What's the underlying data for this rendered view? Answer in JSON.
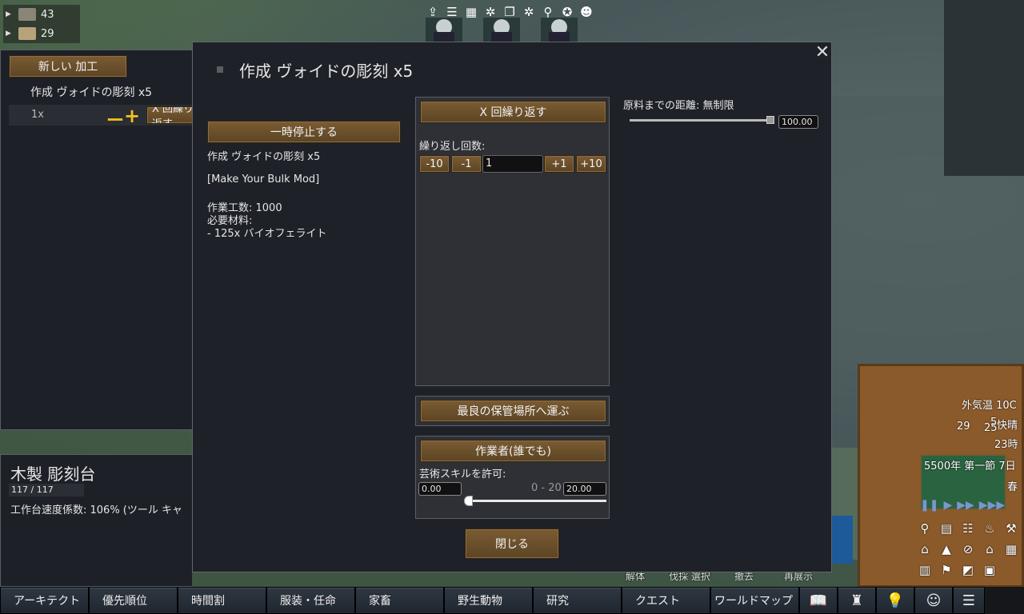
{
  "resources": [
    {
      "icon": "stone-chunk-icon",
      "value": "43",
      "color": "#8a8575"
    },
    {
      "icon": "wood-icon",
      "value": "29",
      "color": "#b8a27a"
    }
  ],
  "top_icons": [
    "draft-icon",
    "work-list-icon",
    "schedule-icon",
    "play-icon",
    "copy-icon",
    "settings-icon",
    "search-icon",
    "palette-icon",
    "face-icon"
  ],
  "bills": {
    "new_bill_label": "新しい 加工",
    "bill_title": "作成 ヴォイドの彫刻 x5",
    "bill_count": "1x",
    "minus": "ー",
    "plus": "+",
    "repeat_label": "X 回繰り返す"
  },
  "inspect": {
    "title": "木製 彫刻台",
    "hp": "117 / 117",
    "speed": "工作台速度係数: 106% (ツール キャ"
  },
  "dialog": {
    "title": "作成 ヴォイドの彫刻 x5",
    "close_x": "✕",
    "pause_label": "一時停止する",
    "info_name": "作成 ヴォイドの彫刻 x5",
    "info_mod": "[Make Your Bulk Mod]",
    "info_work": "作業工数: 1000",
    "info_ingredients_label": "必要材料:",
    "info_ingredient_1": " - 125x バイオフェライト",
    "repeat_mode": "X 回繰り返す",
    "repeat_count_label": "繰り返し回数:",
    "step_minus10": "-10",
    "step_minus1": "-1",
    "repeat_count_value": "1",
    "step_plus1": "+1",
    "step_plus10": "+10",
    "store_label": "最良の保管場所へ運ぶ",
    "worker_label": "作業者(誰でも)",
    "skill_label": "芸術スキルを許可:",
    "skill_min": "0.00",
    "skill_range": "0 - 20",
    "skill_max": "20.00",
    "close_label": "閉じる",
    "distance_label": "原料までの距離: 無制限",
    "distance_value": "100.00"
  },
  "hud": {
    "temp": "外気温 10C",
    "mood": "快晴",
    "count_a": "29",
    "count_b": "25",
    "count_c": "5",
    "hour": "23時",
    "date": "5500年 第一節 7日",
    "season": "春"
  },
  "architect_sub": [
    "解体",
    "伐採 選択",
    "撤去",
    "再展示"
  ],
  "bottom_tabs": [
    "アーキテクト",
    "優先順位",
    "時間割",
    "服装・任命",
    "家畜",
    "野生動物",
    "研究",
    "クエスト",
    "ワールドマップ"
  ],
  "bottom_icons": [
    "book-icon",
    "factions-icon",
    "ideas-icon",
    "astronaut-icon",
    "menu-icon"
  ]
}
